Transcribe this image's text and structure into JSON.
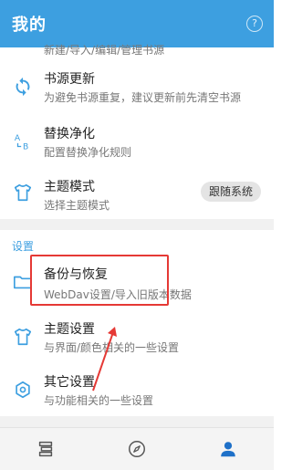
{
  "appbar": {
    "title": "我的",
    "help_icon": "question-circle-icon"
  },
  "partial_text": "新建/导入/编辑/管理书源",
  "items": [
    {
      "title": "书源更新",
      "subtitle": "为避免书源重复，建议更新前先清空书源",
      "icon": "sync-icon"
    },
    {
      "title": "替换净化",
      "subtitle": "配置替换净化规则",
      "icon": "replace-ab-icon"
    },
    {
      "title": "主题模式",
      "subtitle": "选择主题模式",
      "icon": "tshirt-icon",
      "pill": "跟随系统"
    }
  ],
  "section_label": "设置",
  "settings": [
    {
      "title": "备份与恢复",
      "subtitle": "WebDav设置/导入旧版本数据",
      "icon": "folder-icon"
    },
    {
      "title": "主题设置",
      "subtitle": "与界面/颜色相关的一些设置",
      "icon": "tshirt-icon"
    },
    {
      "title": "其它设置",
      "subtitle": "与功能相关的一些设置",
      "icon": "hex-settings-icon"
    }
  ],
  "bottom_nav": [
    "bookshelf-icon",
    "compass-icon",
    "person-icon"
  ],
  "colors": {
    "primary": "#3d9fe0",
    "highlight": "#e53935",
    "active": "#1e70c8"
  }
}
